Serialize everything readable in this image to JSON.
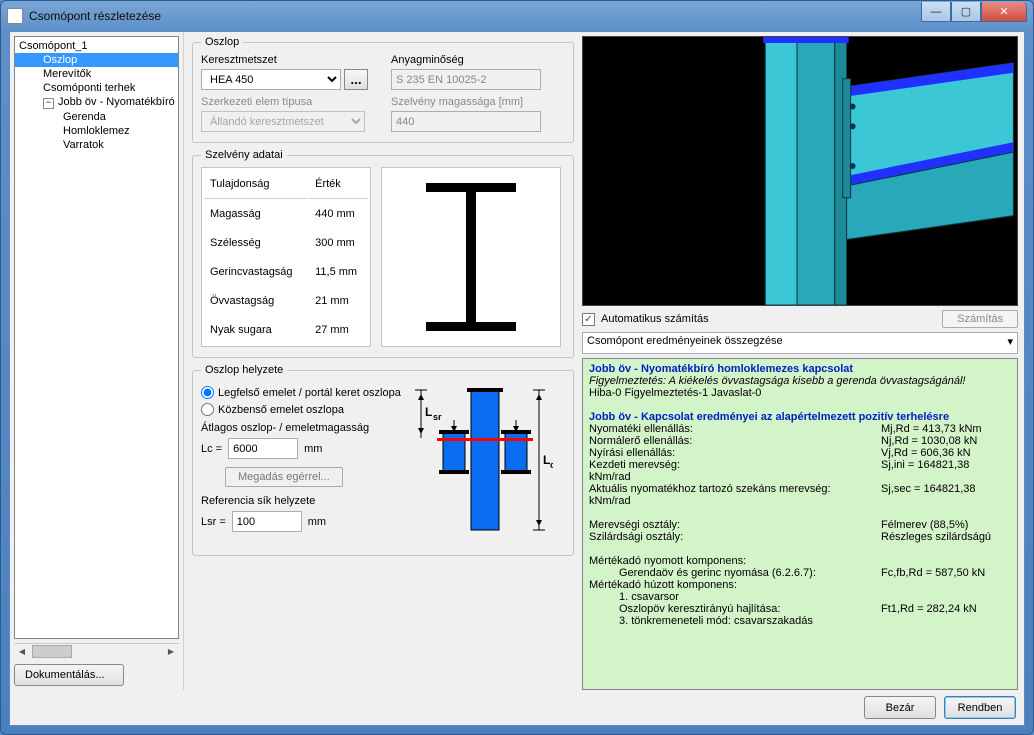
{
  "window": {
    "title": "Csomópont részletezése"
  },
  "tree": {
    "root": "Csomópont_1",
    "items": [
      "Oszlop",
      "Merevítők",
      "Csomóponti terhek"
    ],
    "sub_root": "Jobb öv - Nyomatékbíró hom",
    "sub_items": [
      "Gerenda",
      "Homloklemez",
      "Varratok"
    ]
  },
  "doc_button": "Dokumentálás...",
  "column_group": {
    "legend": "Oszlop",
    "cross_label": "Keresztmetszet",
    "cross_value": "HEA 450",
    "mat_label": "Anyagminőség",
    "mat_value": "S 235 EN 10025-2",
    "struct_label": "Szerkezeti elem típusa",
    "struct_value": "Állandó keresztmetszet",
    "height_label": "Szelvény magassága [mm]",
    "height_value": "440"
  },
  "section_group": {
    "legend": "Szelvény adatai",
    "headers": {
      "prop": "Tulajdonság",
      "val": "Érték"
    },
    "rows": [
      {
        "p": "Magasság",
        "v": "440 mm"
      },
      {
        "p": "Szélesség",
        "v": "300 mm"
      },
      {
        "p": "Gerincvastagság",
        "v": "11,5 mm"
      },
      {
        "p": "Övvastagság",
        "v": "21 mm"
      },
      {
        "p": "Nyak sugara",
        "v": "27 mm"
      }
    ]
  },
  "position_group": {
    "legend": "Oszlop helyzete",
    "radio1": "Legfelső emelet / portál keret oszlopa",
    "radio2": "Közbenső emelet oszlopa",
    "avg_label": "Átlagos oszlop- / emeletmagasság",
    "lc_name": "Lc =",
    "lc_value": "6000",
    "lc_unit": "mm",
    "mouse_btn": "Megadás egérrel...",
    "ref_label": "Referencia sík helyzete",
    "lsr_name": "Lsr =",
    "lsr_value": "100",
    "lsr_unit": "mm"
  },
  "calc": {
    "auto_label": "Automatikus számítás",
    "button": "Számítás",
    "select": "Csomópont eredményeinek összegzése"
  },
  "results": {
    "h1": "Jobb öv - Nyomatékbíró homloklemezes kapcsolat",
    "warn": "Figyelmeztetés: A kiékelés övvastagsága kisebb a gerenda övvastagságánál!",
    "counts": "Hiba-0   Figyelmeztetés-1   Javaslat-0",
    "h2": "Jobb öv - Kapcsolat eredményei az alapértelmezett pozitív terhelésre",
    "rows": [
      {
        "k": "Nyomatéki ellenállás:",
        "v": "Mj,Rd = 413,73 kNm"
      },
      {
        "k": "Normálerő ellenállás:",
        "v": "Nj,Rd = 1030,08 kN"
      },
      {
        "k": "Nyírási ellenállás:",
        "v": "Vj,Rd = 606,36 kN"
      },
      {
        "k": "Kezdeti merevség:",
        "v": "Sj,ini = 164821,38"
      }
    ],
    "unit1": "kNm/rad",
    "row5": {
      "k": "Aktuális nyomatékhoz tartozó szekáns merevség:",
      "v": "Sj,sec = 164821,38"
    },
    "unit2": "kNm/rad",
    "row6": {
      "k": "Merevségi osztály:",
      "v": "Félmerev (88,5%)"
    },
    "row7": {
      "k": "Szilárdsági osztály:",
      "v": "Részleges szilárdságú"
    },
    "comp_h": "Mértékadó nyomott komponens:",
    "comp1": {
      "k": "Gerendaöv és gerinc nyomása (6.2.6.7):",
      "v": "Fc,fb,Rd = 587,50 kN"
    },
    "tens_h": "Mértékadó húzott komponens:",
    "tens1": "1. csavarsor",
    "tens2": {
      "k": "Oszlopöv keresztirányú hajlítása:",
      "v": "Ft1,Rd = 282,24 kN"
    },
    "tens3": "3. tönkremeneteli mód: csavarszakadás"
  },
  "footer": {
    "close": "Bezár",
    "ok": "Rendben"
  }
}
